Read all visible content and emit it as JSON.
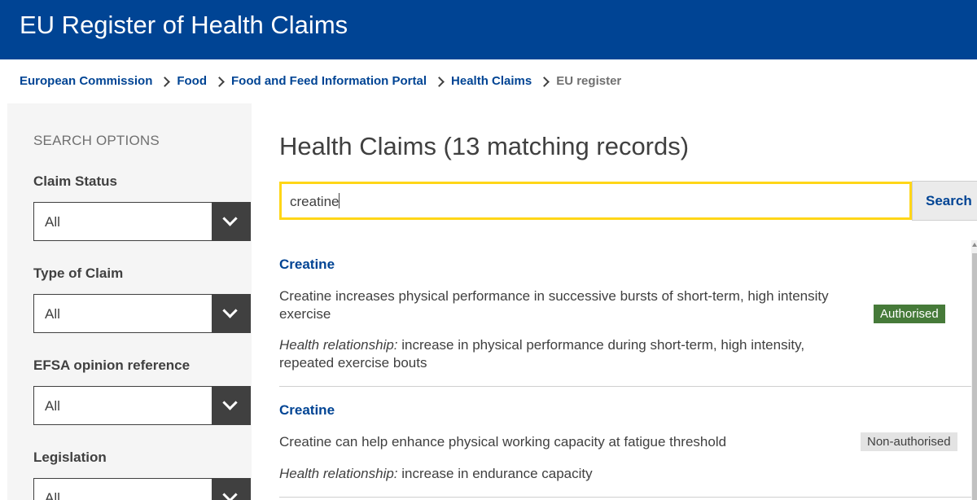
{
  "header": {
    "title": "EU Register of Health Claims"
  },
  "breadcrumb": [
    {
      "label": "European Commission"
    },
    {
      "label": "Food"
    },
    {
      "label": "Food and Feed Information Portal"
    },
    {
      "label": "Health Claims"
    },
    {
      "label": "EU register"
    }
  ],
  "sidebar": {
    "heading": "SEARCH OPTIONS",
    "filters": [
      {
        "label": "Claim Status",
        "value": "All"
      },
      {
        "label": "Type of Claim",
        "value": "All"
      },
      {
        "label": "EFSA opinion reference",
        "value": "All"
      },
      {
        "label": "Legislation",
        "value": "All"
      }
    ]
  },
  "main": {
    "title": "Health Claims (13 matching records)",
    "search": {
      "value": "creatine",
      "button_label": "Search"
    },
    "results": [
      {
        "title": "Creatine",
        "description": "Creatine increases physical performance in successive bursts of short-term, high intensity exercise",
        "relationship_label": "Health relationship:",
        "relationship_text": " increase in physical performance during short-term, high intensity, repeated exercise bouts",
        "status": "Authorised",
        "status_color": "#467a39"
      },
      {
        "title": "Creatine",
        "description": "Creatine can help enhance physical working capacity at fatigue threshold",
        "relationship_label": "Health relationship:",
        "relationship_text": " increase in endurance capacity",
        "status": "Non-authorised",
        "status_color": "#e3e3e3"
      }
    ]
  },
  "icons": {
    "breadcrumb_separator": "chevron-right-icon",
    "select_toggle": "chevron-down-icon"
  },
  "colors": {
    "brand": "#004494",
    "search_focus": "#ffd617"
  }
}
